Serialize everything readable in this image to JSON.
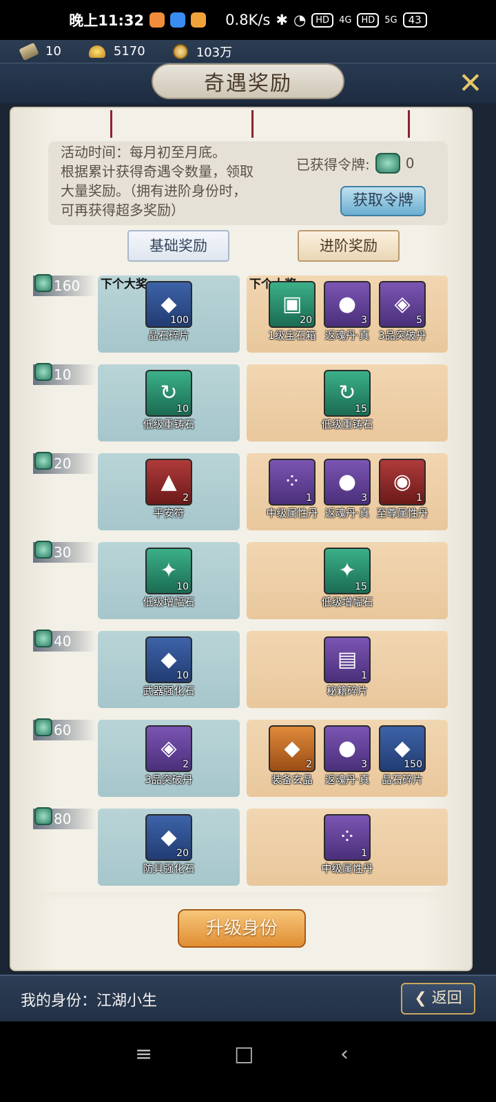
{
  "status_bar": {
    "time": "晚上11:32",
    "speed": "0.8K/s",
    "network_1": "4G",
    "network_2": "5G",
    "hd": "HD",
    "battery": "43"
  },
  "currency": {
    "tickets": "10",
    "gold": "5170",
    "coins": "103万"
  },
  "header": {
    "title": "奇遇奖励",
    "close_icon": "close-x-icon"
  },
  "info": {
    "line1": "活动时间：每月初至月底。",
    "line2": "根据累计获得奇遇令数量，领取",
    "line3": "大量奖励。（拥有进阶身份时，",
    "line4": "可再获得超多奖励）",
    "tokens_label": "已获得令牌:",
    "tokens_value": "0",
    "get_token_button": "获取令牌"
  },
  "tabs": {
    "basic": "基础奖励",
    "advanced": "进阶奖励"
  },
  "next_prize_label": "下个大奖",
  "rows": [
    {
      "threshold": "160",
      "basic": [
        {
          "name": "晶石碎片",
          "qty": "100",
          "color": "blue",
          "glyph": "◆"
        }
      ],
      "advanced": [
        {
          "name": "1级宝石箱",
          "qty": "20",
          "color": "green",
          "glyph": "▣"
        },
        {
          "name": "返魂丹·真",
          "qty": "3",
          "color": "purple",
          "glyph": "●"
        },
        {
          "name": "3品突破丹",
          "qty": "5",
          "color": "purple",
          "glyph": "◈"
        }
      ]
    },
    {
      "threshold": "10",
      "basic": [
        {
          "name": "低级重铸石",
          "qty": "10",
          "color": "green",
          "glyph": "↻"
        }
      ],
      "advanced": [
        {
          "name": "低级重铸石",
          "qty": "15",
          "color": "green",
          "glyph": "↻"
        }
      ]
    },
    {
      "threshold": "20",
      "basic": [
        {
          "name": "平安符",
          "qty": "2",
          "color": "red",
          "glyph": "▲"
        }
      ],
      "advanced": [
        {
          "name": "中级属性丹",
          "qty": "1",
          "color": "purple",
          "glyph": "⁘"
        },
        {
          "name": "返魂丹·真",
          "qty": "3",
          "color": "purple",
          "glyph": "●"
        },
        {
          "name": "至尊属性丹",
          "qty": "1",
          "color": "red",
          "glyph": "◉"
        }
      ]
    },
    {
      "threshold": "30",
      "basic": [
        {
          "name": "低级增幅石",
          "qty": "10",
          "color": "green",
          "glyph": "✦"
        }
      ],
      "advanced": [
        {
          "name": "低级增幅石",
          "qty": "15",
          "color": "green",
          "glyph": "✦"
        }
      ]
    },
    {
      "threshold": "40",
      "basic": [
        {
          "name": "武器强化石",
          "qty": "10",
          "color": "blue",
          "glyph": "◆"
        }
      ],
      "advanced": [
        {
          "name": "秘籍碎片",
          "qty": "1",
          "color": "purple",
          "glyph": "▤"
        }
      ]
    },
    {
      "threshold": "60",
      "basic": [
        {
          "name": "3品突破丹",
          "qty": "2",
          "color": "purple",
          "glyph": "◈"
        }
      ],
      "advanced": [
        {
          "name": "装备玄晶",
          "qty": "2",
          "color": "orange",
          "glyph": "◆"
        },
        {
          "name": "返魂丹·真",
          "qty": "3",
          "color": "purple",
          "glyph": "●"
        },
        {
          "name": "晶石碎片",
          "qty": "150",
          "color": "blue",
          "glyph": "◆"
        }
      ]
    },
    {
      "threshold": "80",
      "basic": [
        {
          "name": "防具强化石",
          "qty": "20",
          "color": "blue",
          "glyph": "◆"
        }
      ],
      "advanced": [
        {
          "name": "中级属性丹",
          "qty": "1",
          "color": "purple",
          "glyph": "⁘"
        }
      ]
    }
  ],
  "upgrade_button": "升级身份",
  "bottom": {
    "identity": "我的身份：江湖小生",
    "back_button": "返回"
  },
  "nav": {
    "menu": "≡",
    "home": "□",
    "back": "‹"
  }
}
